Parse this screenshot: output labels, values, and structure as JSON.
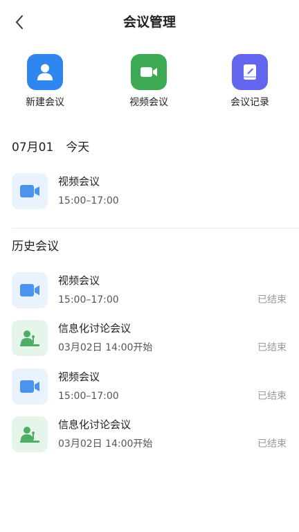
{
  "header": {
    "title": "会议管理"
  },
  "quick_actions": [
    {
      "label": "新建会议",
      "icon": "person-icon",
      "color": "#2f86ef"
    },
    {
      "label": "视频会议",
      "icon": "video-camera-icon",
      "color": "#3ea955"
    },
    {
      "label": "会议记录",
      "icon": "notebook-icon",
      "color": "#6266ee"
    }
  ],
  "today": {
    "date": "07月01",
    "label": "今天",
    "meetings": [
      {
        "name": "视频会议",
        "time": "15:00–17:00",
        "type": "video"
      }
    ]
  },
  "history": {
    "title": "历史会议",
    "meetings": [
      {
        "name": "视频会议",
        "time": "15:00–17:00",
        "status": "已结束",
        "type": "video"
      },
      {
        "name": "信息化讨论会议",
        "time": "03月02日 14:00开始",
        "status": "已结束",
        "type": "discussion"
      },
      {
        "name": "视频会议",
        "time": "15:00–17:00",
        "status": "已结束",
        "type": "video"
      },
      {
        "name": "信息化讨论会议",
        "time": "03月02日 14:00开始",
        "status": "已结束",
        "type": "discussion"
      }
    ]
  },
  "colors": {
    "video_icon": "#4a94f0",
    "video_bg": "#eaf2fe",
    "discussion_icon": "#4fae63",
    "discussion_bg": "#e6f5e9"
  }
}
